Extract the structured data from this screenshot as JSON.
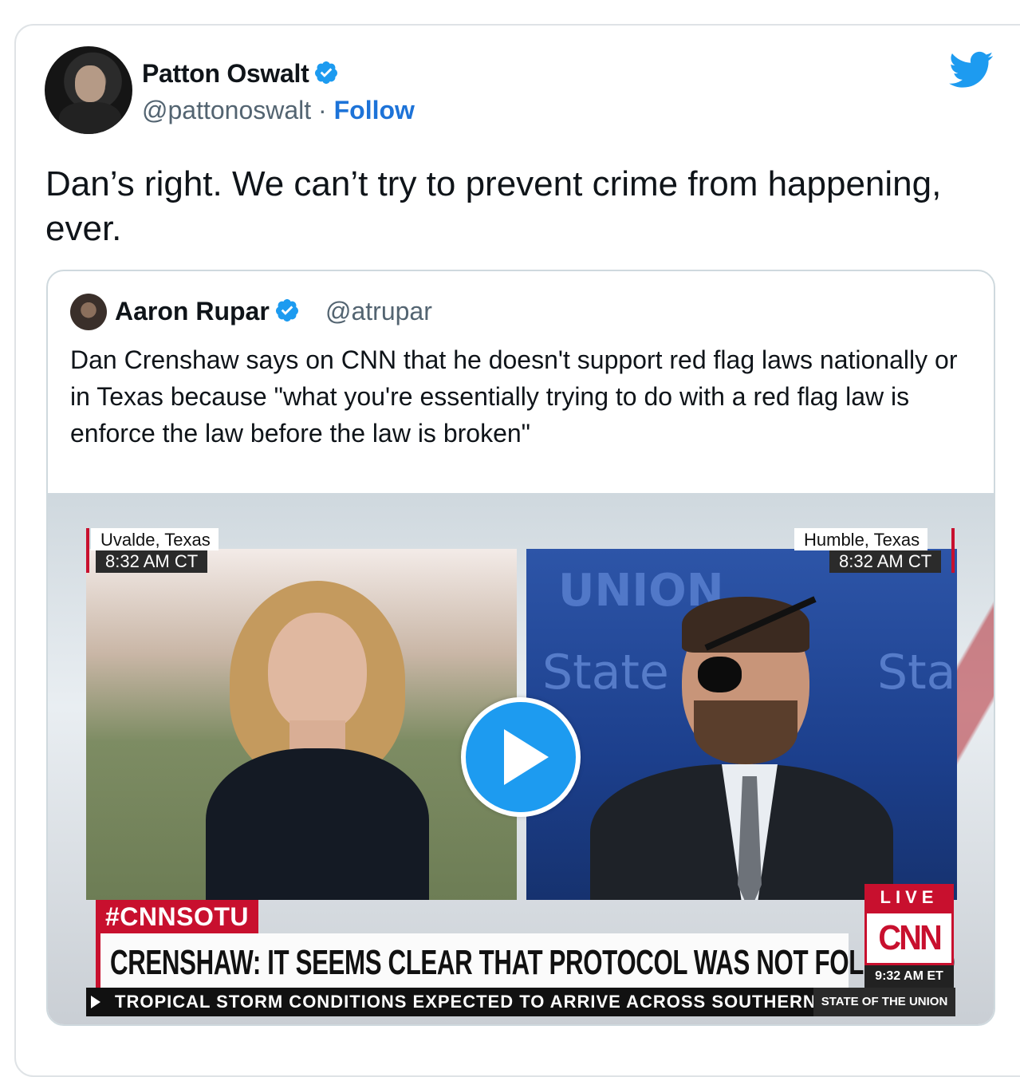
{
  "tweet": {
    "author_name": "Patton Oswalt",
    "author_handle": "@pattonoswalt",
    "separator": "·",
    "follow_label": "Follow",
    "text": "Dan’s right. We can’t try to prevent crime from happening, ever."
  },
  "quoted": {
    "author_name": "Aaron Rupar",
    "author_handle": "@atrupar",
    "text": "Dan Crenshaw says on CNN that he doesn't support red flag laws nationally or in Texas because \"what you're essentially trying to do with a red flag law is enforce the law before the law is broken\""
  },
  "video": {
    "left_location": "Uvalde, Texas",
    "left_time": "8:32 AM CT",
    "right_location": "Humble, Texas",
    "right_time": "8:32 AM CT",
    "bg_text_union": "UNION",
    "bg_text_state": "State",
    "bg_text_state2": "Sta",
    "hashtag": "#CNNSOTU",
    "banner": "CRENSHAW: IT SEEMS CLEAR THAT PROTOCOL WAS NOT FOLLOWED",
    "live_label": "LIVE",
    "network_logo": "CNN",
    "network_time": "9:32 AM ET",
    "ticker": "TROPICAL STORM CONDITIONS EXPECTED TO ARRIVE ACROSS SOUTHERN",
    "ticker_right": "STATE OF THE UNION"
  },
  "colors": {
    "twitter_blue": "#1d9bf0",
    "follow_blue": "#1d73d8",
    "cnn_red": "#c8102e",
    "verified_blue": "#1d9bf0"
  },
  "icons": {
    "verified": "verified-badge-icon",
    "twitter": "twitter-bird-icon",
    "play": "play-icon"
  }
}
